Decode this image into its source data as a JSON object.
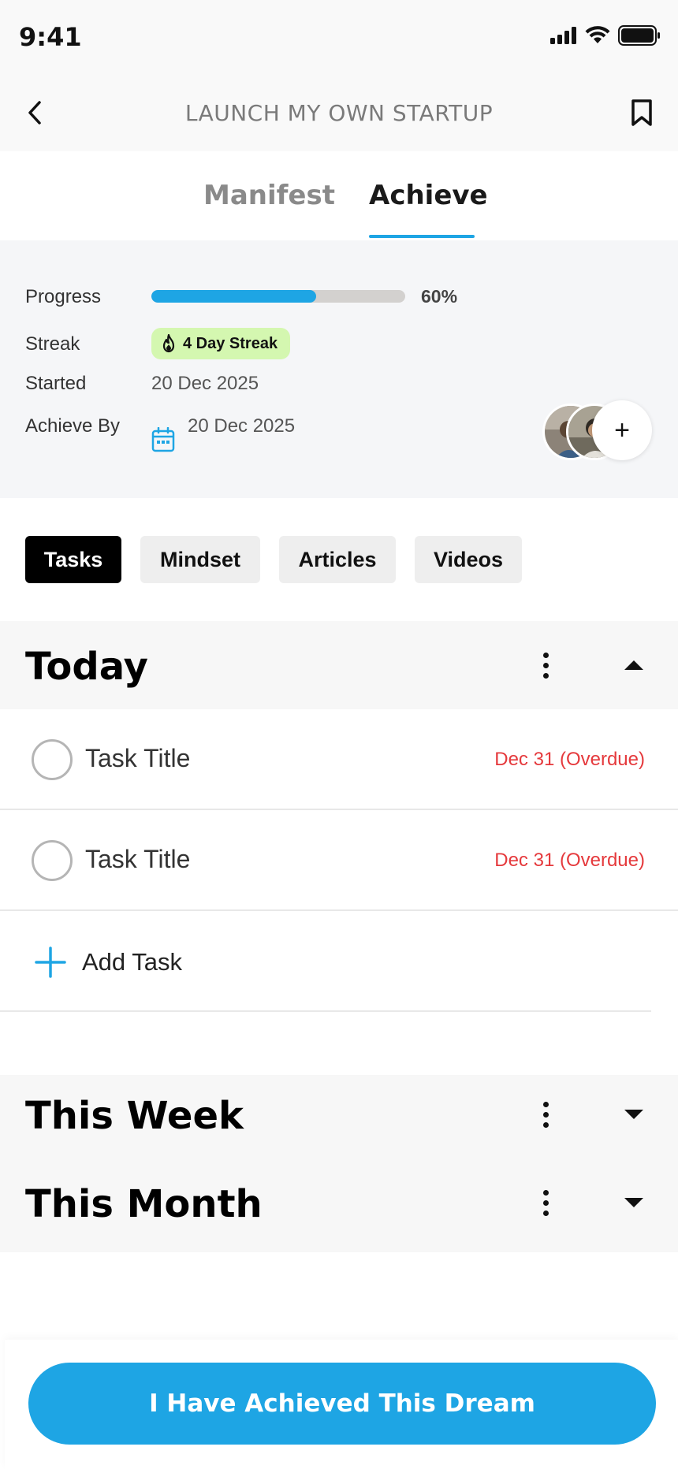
{
  "status_bar": {
    "time": "9:41"
  },
  "header": {
    "title": "LAUNCH MY OWN STARTUP"
  },
  "tabs": [
    {
      "label": "Manifest",
      "active": false
    },
    {
      "label": "Achieve",
      "active": true
    }
  ],
  "info": {
    "progress_label": "Progress",
    "progress_percent_text": "60%",
    "progress_value": 0.65,
    "streak_label": "Streak",
    "streak_badge": "4 Day Streak",
    "started_label": "Started",
    "started_date": "20 Dec 2025",
    "achieve_by_label": "Achieve By",
    "achieve_by_date": "20 Dec 2025",
    "add_member_symbol": "+"
  },
  "filters": [
    {
      "label": "Tasks",
      "active": true
    },
    {
      "label": "Mindset",
      "active": false
    },
    {
      "label": "Articles",
      "active": false
    },
    {
      "label": "Videos",
      "active": false
    }
  ],
  "sections": {
    "today": {
      "title": "Today",
      "expanded": true
    },
    "this_week": {
      "title": "This Week",
      "expanded": false
    },
    "this_month": {
      "title": "This Month",
      "expanded": false
    }
  },
  "tasks": [
    {
      "title": "Task Title",
      "due": "Dec 31 (Overdue)"
    },
    {
      "title": "Task Title",
      "due": "Dec 31 (Overdue)"
    }
  ],
  "add_task_label": "Add Task",
  "cta_label": "I Have Achieved This Dream",
  "colors": {
    "accent": "#1ea5e4",
    "overdue": "#e5393c",
    "streak_bg": "#d4f7b0"
  }
}
